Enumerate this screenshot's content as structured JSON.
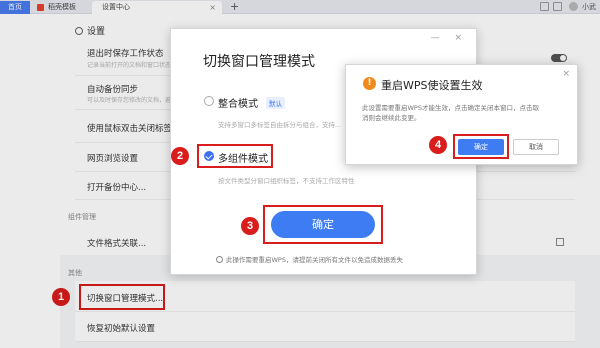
{
  "tabs": {
    "home": "首页",
    "template": "稻壳模板",
    "settings": "设置中心",
    "close_glyph": "×",
    "add_glyph": "+"
  },
  "user": {
    "name": "小武"
  },
  "settings": {
    "header": "设置",
    "rows": [
      {
        "title": "退出时保存工作状态",
        "desc": "记录当前打开的文档和窗口状态，下次启动时自动恢复"
      },
      {
        "title": "自动备份同步",
        "desc": "可以及时保存您修改的文档，避免数据丢失"
      },
      {
        "title": "使用鼠标双击关闭标签",
        "desc": ""
      },
      {
        "title": "网页浏览设置",
        "desc": ""
      },
      {
        "title": "打开备份中心...",
        "desc": ""
      }
    ],
    "sections": {
      "components_label": "组件管理",
      "file_assoc": "文件格式关联...",
      "other_label": "其他",
      "switch_mode": "切换窗口管理模式...",
      "restore_default": "恢复初始默认设置"
    }
  },
  "dialog": {
    "title": "切换窗口管理模式",
    "option_integrated": "整合模式",
    "option_integrated_tag": "默认",
    "option_integrated_desc": "支持多窗口多标签自由拆分与组合，支持...",
    "option_multi": "多组件模式",
    "option_multi_desc": "按文件类型分窗口组织标签，不支持工作区特性",
    "ok_label": "确定",
    "notice": "此操作需要重启WPS，请提前关闭所有文件以免造成数据丢失",
    "ctrl_glyphs": "— ×"
  },
  "dialog2": {
    "title": "重启WPS使设置生效",
    "warn_glyph": "!",
    "text_line1": "此设置需要重启WPS才能生效，点击确定关闭本窗口，点击取",
    "text_line2": "消则会继续此变更。",
    "ok_label": "确定",
    "cancel_label": "取消",
    "close_glyph": "×"
  },
  "steps": [
    "1",
    "2",
    "3",
    "4"
  ],
  "colors": {
    "accent": "#3d7cf3",
    "marker": "#d91c1c",
    "warn": "#f08a1c"
  }
}
